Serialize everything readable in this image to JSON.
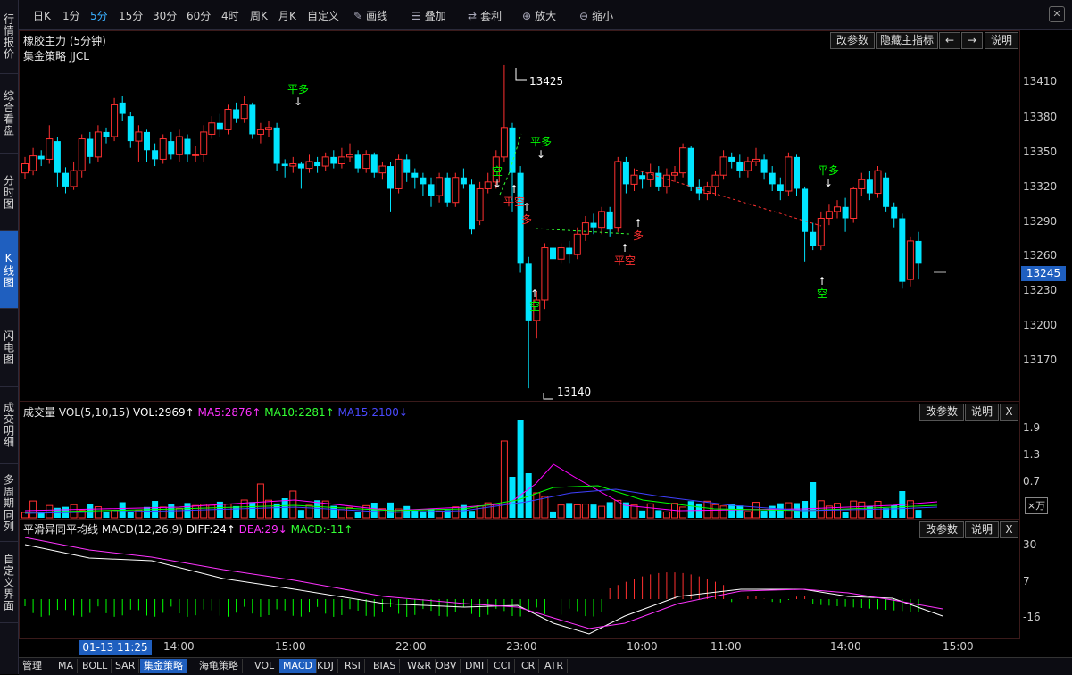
{
  "sidebar": {
    "items": [
      {
        "label": "行情报价",
        "active": false
      },
      {
        "label": "综合看盘",
        "active": false
      },
      {
        "label": "分时图",
        "active": false
      },
      {
        "label": "K线图",
        "active": true
      },
      {
        "label": "闪电图",
        "active": false
      },
      {
        "label": "成交明细",
        "active": false
      },
      {
        "label": "多周期同列",
        "active": false
      },
      {
        "label": "自定义界面",
        "active": false
      }
    ]
  },
  "toolbar": {
    "periods": [
      "日K",
      "1分",
      "5分",
      "15分",
      "30分",
      "60分",
      "4时",
      "周K",
      "月K",
      "自定义"
    ],
    "active_period": "5分",
    "draw": "画线",
    "overlay": "叠加",
    "arbitrage": "套利",
    "zoom_in": "放大",
    "zoom_out": "缩小",
    "close": "✕"
  },
  "main": {
    "title": "橡胶主力 (5分钟)",
    "strategy": "集金策略 JJCL",
    "buttons": {
      "params": "改参数",
      "hide": "隐藏主指标",
      "left": "←",
      "right": "→",
      "help": "说明"
    },
    "high_label": "13425",
    "low_label": "13140",
    "current_price": "13245",
    "yaxis": [
      "13410",
      "13380",
      "13350",
      "13320",
      "13290",
      "13260",
      "13230",
      "13200",
      "13170"
    ],
    "signals": {
      "ping_duo_1": "平多",
      "kong_1": "空",
      "ping_kong_1": "平空",
      "duo_1": "多",
      "ping_duo_2": "平多",
      "kong_2": "空",
      "duo_2": "多",
      "ping_kong_2": "平空",
      "ping_duo_3": "平多",
      "kong_3": "空"
    }
  },
  "volume": {
    "title": "成交量 VOL(5,10,15)",
    "vol": "VOL:2969↑",
    "ma5": "MA5:2876↑",
    "ma10": "MA10:2281↑",
    "ma15": "MA15:2100↓",
    "buttons": {
      "params": "改参数",
      "help": "说明",
      "close": "X"
    },
    "yaxis": [
      "1.9",
      "1.3",
      "0.7"
    ],
    "unit": "×万"
  },
  "macd": {
    "title": "平滑异同平均线 MACD(12,26,9)",
    "diff": "DIFF:24↑",
    "dea": "DEA:29↓",
    "macd": "MACD:-11↑",
    "buttons": {
      "params": "改参数",
      "help": "说明",
      "close": "X"
    },
    "yaxis": [
      "30",
      "7",
      "-16"
    ]
  },
  "xaxis": {
    "cursor_time": "01-13 11:25",
    "ticks": [
      "14:00",
      "15:00",
      "22:00",
      "23:00",
      "10:00",
      "11:00",
      "14:00",
      "15:00"
    ]
  },
  "bottom_tabs": {
    "items": [
      "管理",
      "MA",
      "BOLL",
      "SAR",
      "集金策略",
      "海龟策略",
      "VOL",
      "MACD",
      "KDJ",
      "RSI",
      "BIAS",
      "W&R",
      "OBV",
      "DMI",
      "CCI",
      "CR",
      "ATR"
    ],
    "active": [
      "集金策略",
      "MACD"
    ]
  },
  "colors": {
    "up": "#ff3030",
    "down": "#00e5ff",
    "bull_signal": "#00ff00",
    "bear_signal": "#ff3030",
    "ma5": "#ff00ff",
    "ma10": "#00ff00",
    "ma15": "#4040ff",
    "dea": "#ff33ff",
    "diff": "#ffffff"
  }
}
